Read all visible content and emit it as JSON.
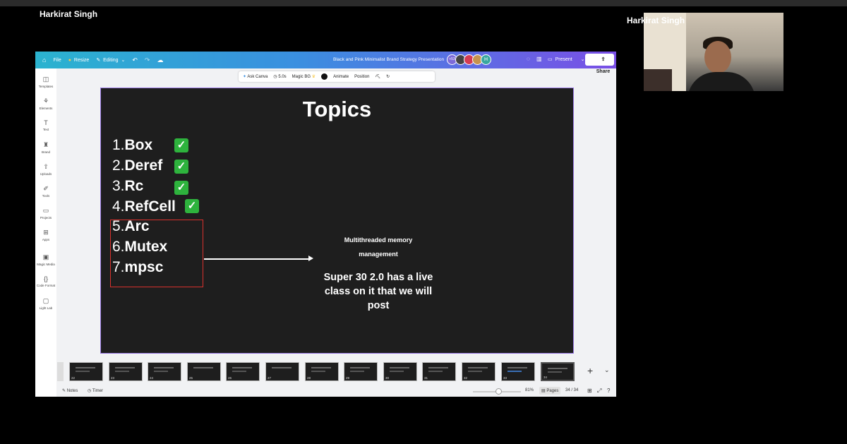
{
  "meeting": {
    "presenter_name": "Harkirat Singh",
    "camera_name": "Harkirat Singh"
  },
  "canva": {
    "toolbar": {
      "file": "File",
      "resize": "Resize",
      "editing": "Editing",
      "doc_title": "Black and Pink Minimalist Brand Strategy Presentation",
      "collab_count": "+53",
      "avatar_letter": "H",
      "present": "Present",
      "share": "Share"
    },
    "context_bar": {
      "ask_canva": "Ask Canva",
      "duration": "5.0s",
      "magic_bg": "Magic BG",
      "animate": "Animate",
      "position": "Position"
    },
    "sidebar": [
      "Templates",
      "Elements",
      "Text",
      "Brand",
      "Uploads",
      "Tools",
      "Projects",
      "Apps",
      "Magic Media",
      "Code Format",
      "Light Lab"
    ],
    "slide": {
      "title": "Topics",
      "topics": [
        {
          "num": "1.",
          "label": "Box",
          "done": true
        },
        {
          "num": "2.",
          "label": "Deref",
          "done": true
        },
        {
          "num": "3.",
          "label": "Rc",
          "done": true
        },
        {
          "num": "4.",
          "label": "RefCell",
          "done": true
        },
        {
          "num": "5.",
          "label": "Arc",
          "done": false
        },
        {
          "num": "6.",
          "label": "Mutex",
          "done": false
        },
        {
          "num": "7.",
          "label": "mpsc",
          "done": false
        }
      ],
      "note_small": "Multithreaded memory management",
      "note_large": "Super 30 2.0 has a live class on it that we will post",
      "highlight_color": "#d9312d",
      "check_color": "#2eb33d"
    },
    "thumbnails": [
      "22",
      "23",
      "24",
      "25",
      "26",
      "27",
      "28",
      "29",
      "30",
      "31",
      "32",
      "33",
      "34"
    ],
    "bottom": {
      "notes": "Notes",
      "timer": "Timer",
      "zoom": "81%",
      "pages": "Pages",
      "page_count": "34 / 34"
    }
  }
}
